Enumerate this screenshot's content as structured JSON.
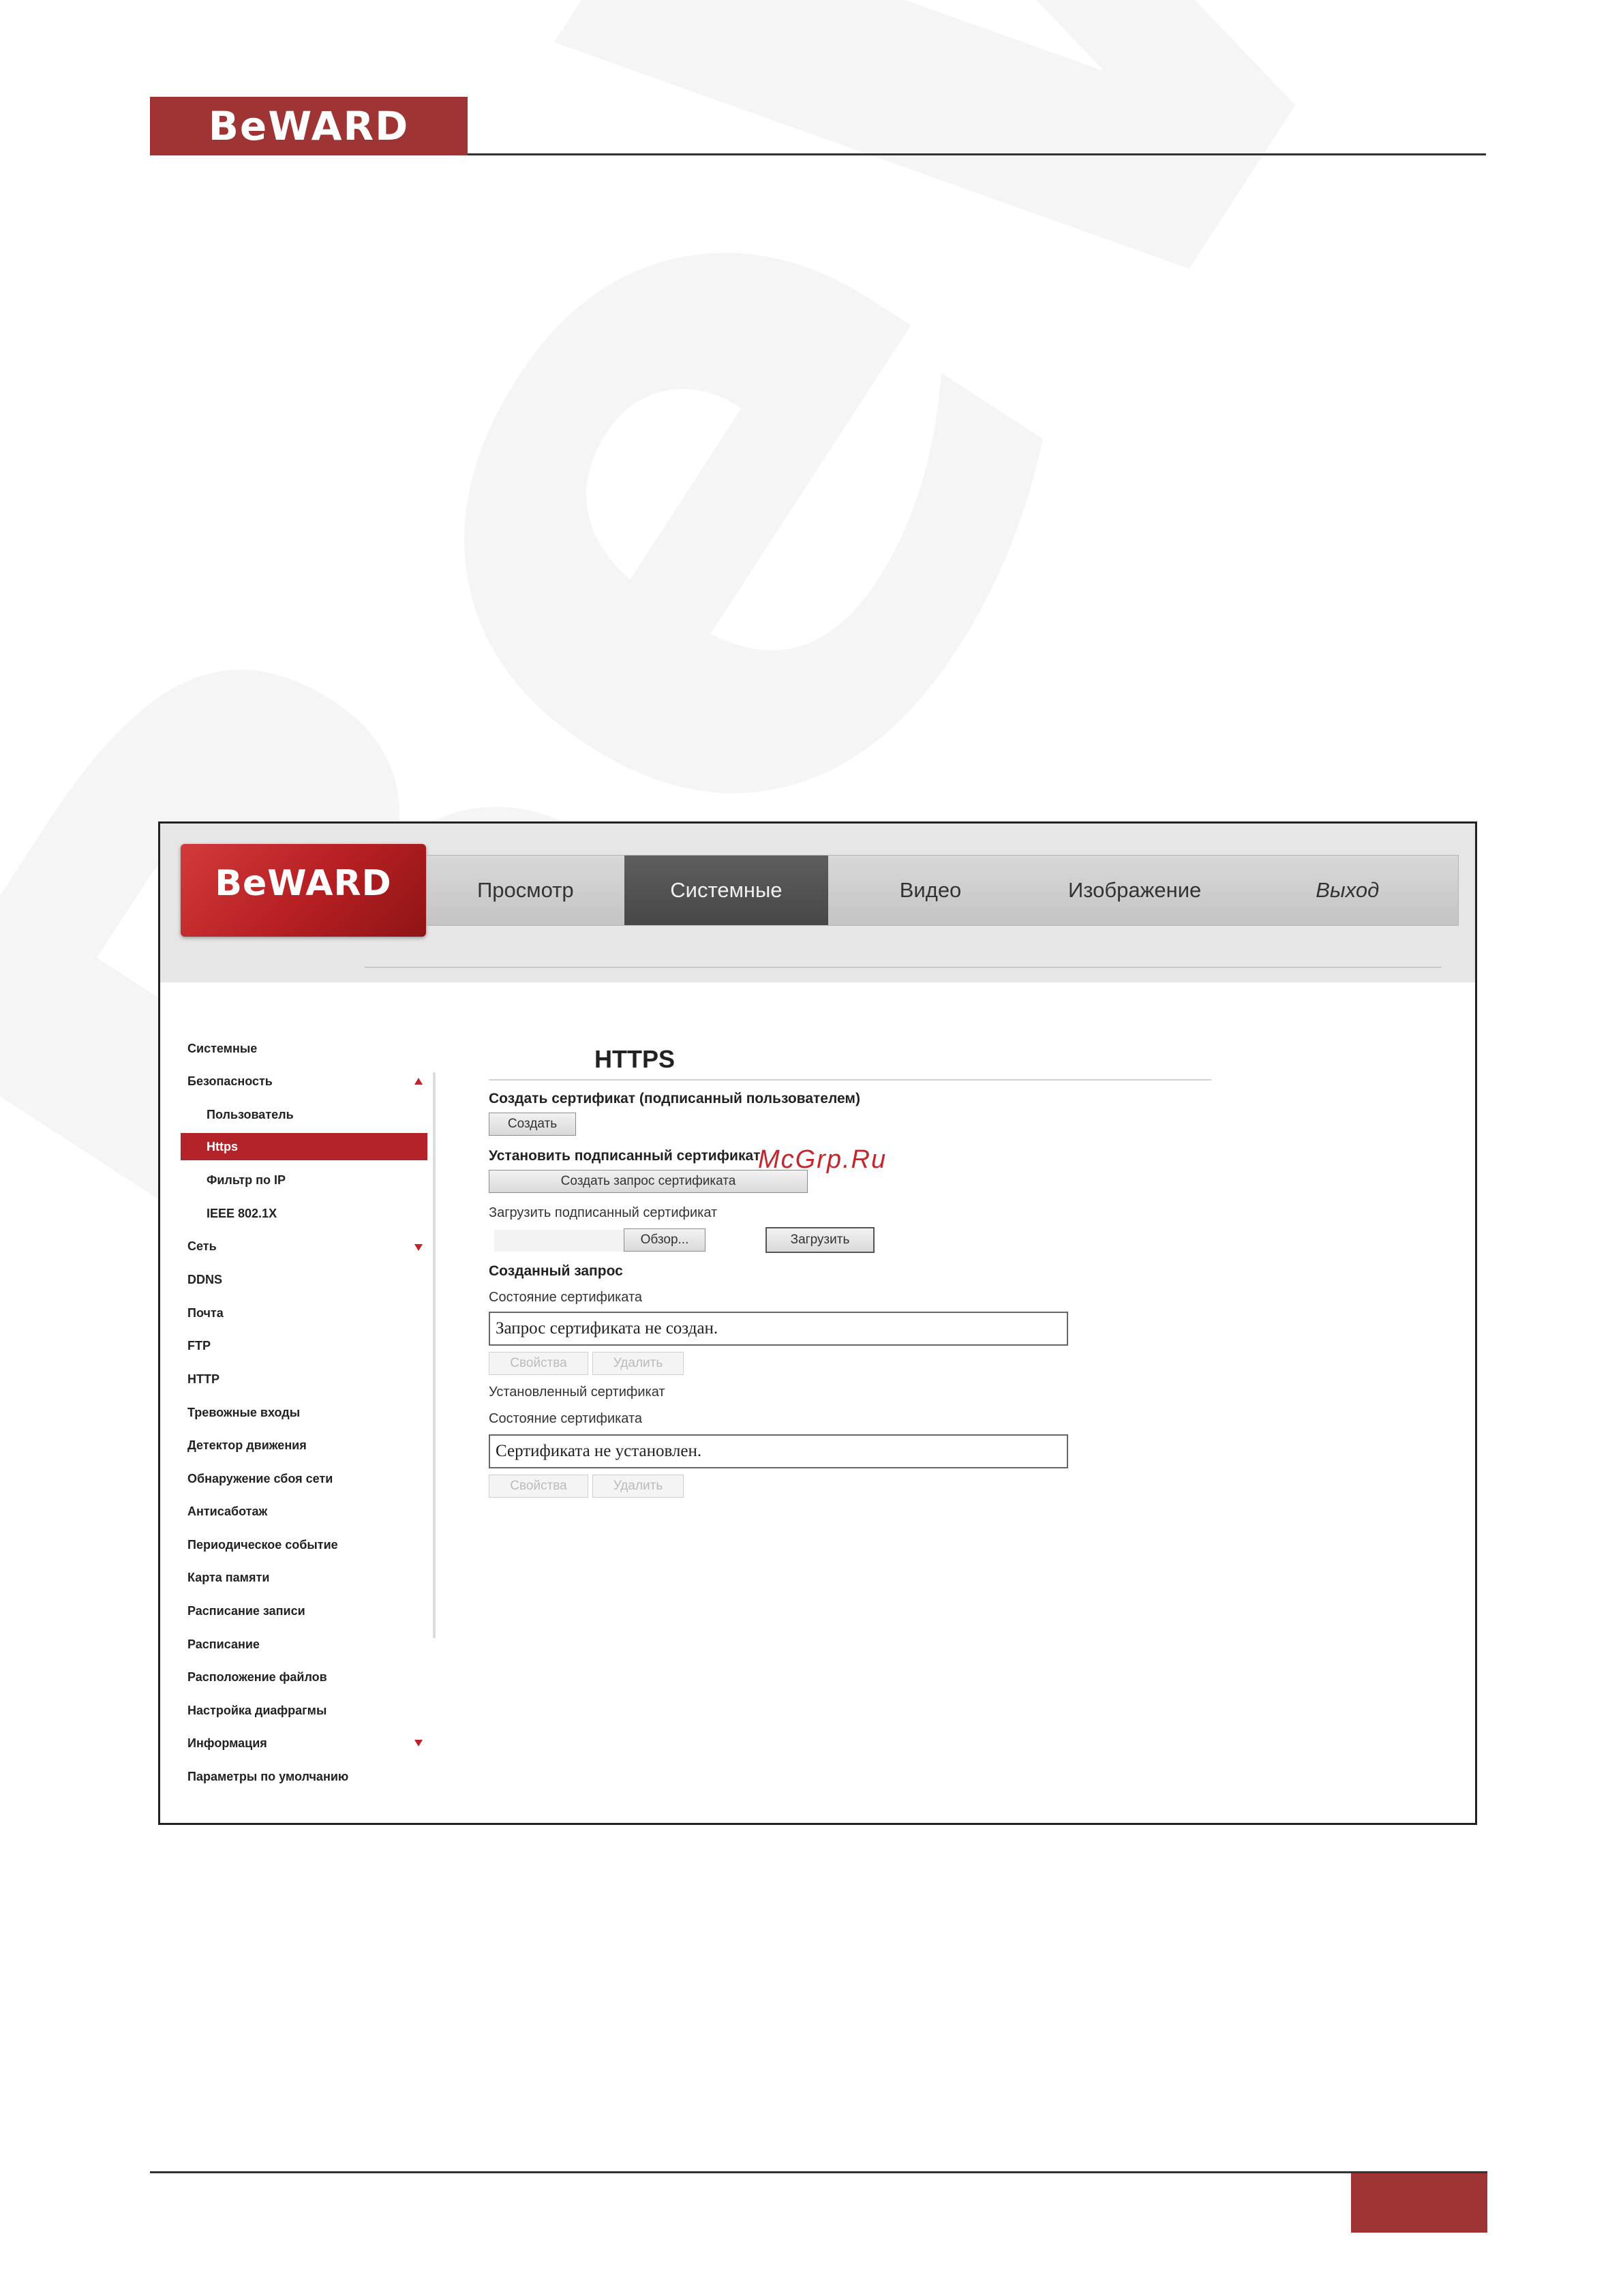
{
  "document": {
    "logo_text": "BeWARD",
    "watermark": "BeWARD",
    "overlay_mark": "McGrp.Ru",
    "accent_color": "#9e3534"
  },
  "camera_ui": {
    "logo_text": "BeWARD",
    "nav": [
      "Просмотр",
      "Системные",
      "Видео",
      "Изображение",
      "Выход"
    ],
    "active_nav": "Системные",
    "sidebar": [
      {
        "label": "Системные"
      },
      {
        "label": "Безопасность",
        "arrow": "up"
      },
      {
        "label": "Пользователь"
      },
      {
        "label": "Https",
        "selected": true
      },
      {
        "label": "Фильтр по IP"
      },
      {
        "label": "IEEE 802.1X"
      },
      {
        "label": "Сеть",
        "arrow": "down"
      },
      {
        "label": "DDNS"
      },
      {
        "label": "Почта"
      },
      {
        "label": "FTP"
      },
      {
        "label": "HTTP"
      },
      {
        "label": "Тревожные входы"
      },
      {
        "label": "Детектор движения"
      },
      {
        "label": "Обнаружение сбоя сети"
      },
      {
        "label": "Антисаботаж"
      },
      {
        "label": "Периодическое событие"
      },
      {
        "label": "Карта памяти"
      },
      {
        "label": "Расписание записи"
      },
      {
        "label": "Расписание"
      },
      {
        "label": "Расположение файлов"
      },
      {
        "label": "Настройка диафрагмы"
      },
      {
        "label": "Информация",
        "arrow": "down"
      },
      {
        "label": "Параметры по умолчанию"
      }
    ],
    "https": {
      "title": "HTTPS",
      "create_cert_heading": "Создать сертификат (подписанный пользователем)",
      "create_button": "Создать",
      "install_signed_heading": "Установить подписанный сертификат",
      "create_request_button": "Создать запрос сертификата",
      "upload_signed_label": "Загрузить подписанный сертификат",
      "browse_button": "Обзор...",
      "upload_button": "Загрузить",
      "created_request_heading": "Созданный запрос",
      "request_status_label": "Состояние сертификата",
      "request_status_value": "Запрос сертификата не создан.",
      "properties_button": "Свойства",
      "delete_button": "Удалить",
      "installed_cert_label": "Установленный сертификат",
      "installed_status_label": "Состояние сертификата",
      "installed_status_value": "Сертификата не установлен.",
      "properties_button_2": "Свойства",
      "delete_button_2": "Удалить"
    }
  }
}
